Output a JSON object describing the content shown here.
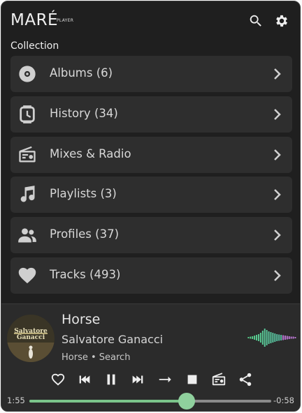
{
  "app": {
    "logo": "MARÉ",
    "logo_sub": "PLAYER"
  },
  "header": {
    "search_icon": "search-icon",
    "settings_icon": "gear-icon"
  },
  "collection": {
    "title": "Collection",
    "items": [
      {
        "label": "Albums (6)",
        "icon": "album-disc-icon"
      },
      {
        "label": "History (34)",
        "icon": "history-clock-icon"
      },
      {
        "label": "Mixes & Radio",
        "icon": "radio-icon"
      },
      {
        "label": "Playlists (3)",
        "icon": "music-note-icon"
      },
      {
        "label": "Profiles (37)",
        "icon": "people-icon"
      },
      {
        "label": "Tracks (493)",
        "icon": "heart-icon"
      }
    ]
  },
  "player": {
    "title": "Horse",
    "artist": "Salvatore Ganacci",
    "subtitle": "Horse • Search",
    "cover_text": "Salvatore Ganacci",
    "elapsed": "1:55",
    "remaining": "-0:58",
    "progress": 0.65,
    "colors": {
      "accent": "#7bc48a"
    },
    "controls": [
      "heart-icon",
      "skip-previous-icon",
      "pause-icon",
      "skip-next-icon",
      "repeat-off-icon",
      "stop-icon",
      "radio-icon",
      "share-icon"
    ]
  }
}
